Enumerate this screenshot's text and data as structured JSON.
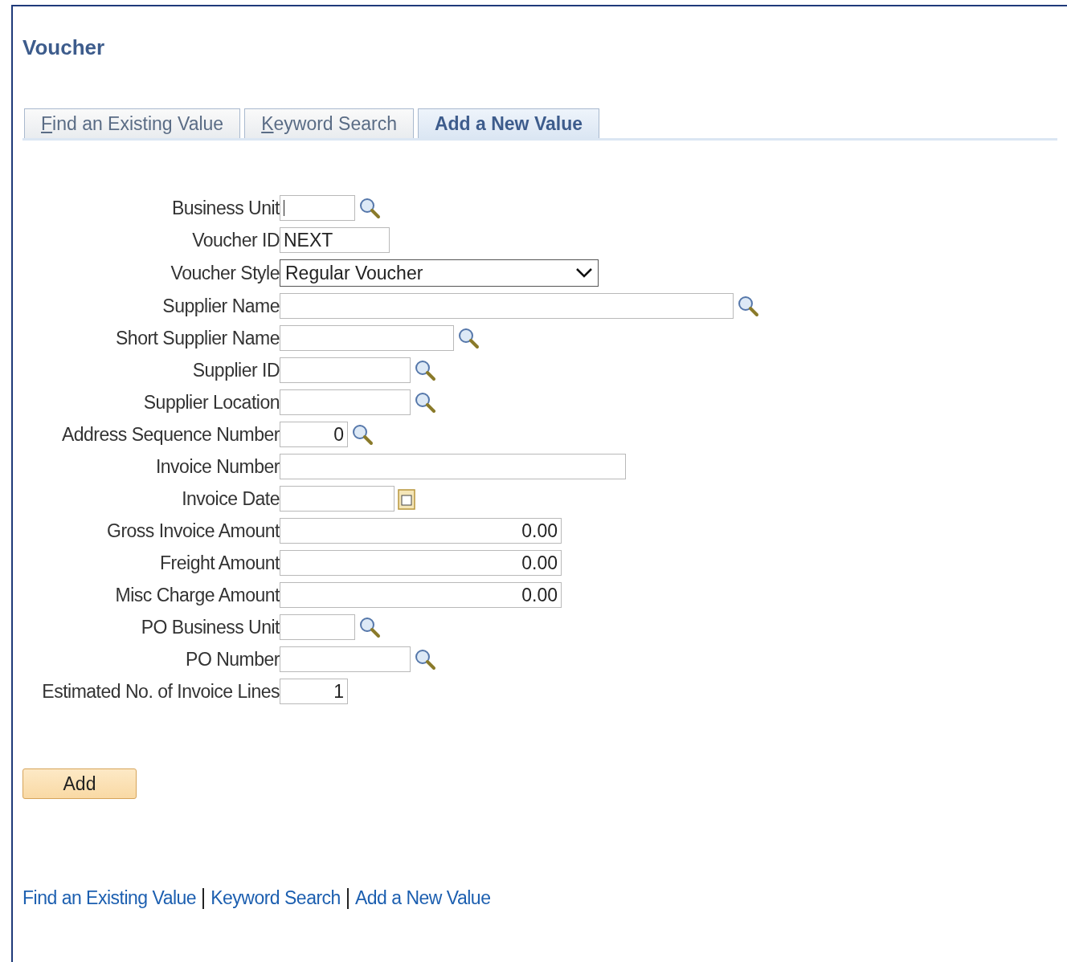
{
  "page": {
    "title": "Voucher"
  },
  "tabs": [
    {
      "label": "Find an Existing Value",
      "mnemonic": true,
      "selected": false
    },
    {
      "label": "Keyword Search",
      "mnemonic": true,
      "selected": false
    },
    {
      "label": "Add a New Value",
      "mnemonic": false,
      "selected": true
    }
  ],
  "fields": [
    {
      "label": "Business Unit",
      "kind": "lookup",
      "focused": true
    },
    {
      "label": "Voucher ID",
      "kind": "text",
      "value": "NEXT"
    },
    {
      "label": "Voucher Style",
      "kind": "select",
      "value": "Regular Voucher"
    },
    {
      "label": "Supplier Name",
      "kind": "lookup"
    },
    {
      "label": "Short Supplier Name",
      "kind": "lookup"
    },
    {
      "label": "Supplier ID",
      "kind": "lookup"
    },
    {
      "label": "Supplier Location",
      "kind": "lookup"
    },
    {
      "label": "Address Sequence Number",
      "kind": "number-lookup",
      "value": "0"
    },
    {
      "label": "Invoice Number",
      "kind": "text"
    },
    {
      "label": "Invoice Date",
      "kind": "date"
    },
    {
      "label": "Gross Invoice Amount",
      "kind": "number",
      "value": "0.00"
    },
    {
      "label": "Freight Amount",
      "kind": "number",
      "value": "0.00"
    },
    {
      "label": "Misc Charge Amount",
      "kind": "number",
      "value": "0.00"
    },
    {
      "label": "PO Business Unit",
      "kind": "lookup"
    },
    {
      "label": "PO Number",
      "kind": "lookup"
    },
    {
      "label": "Estimated No. of Invoice Lines",
      "kind": "number",
      "value": "1"
    }
  ],
  "add_button": "Add",
  "footer_links": [
    "Find an Existing Value",
    "Keyword Search",
    "Add a New Value"
  ]
}
